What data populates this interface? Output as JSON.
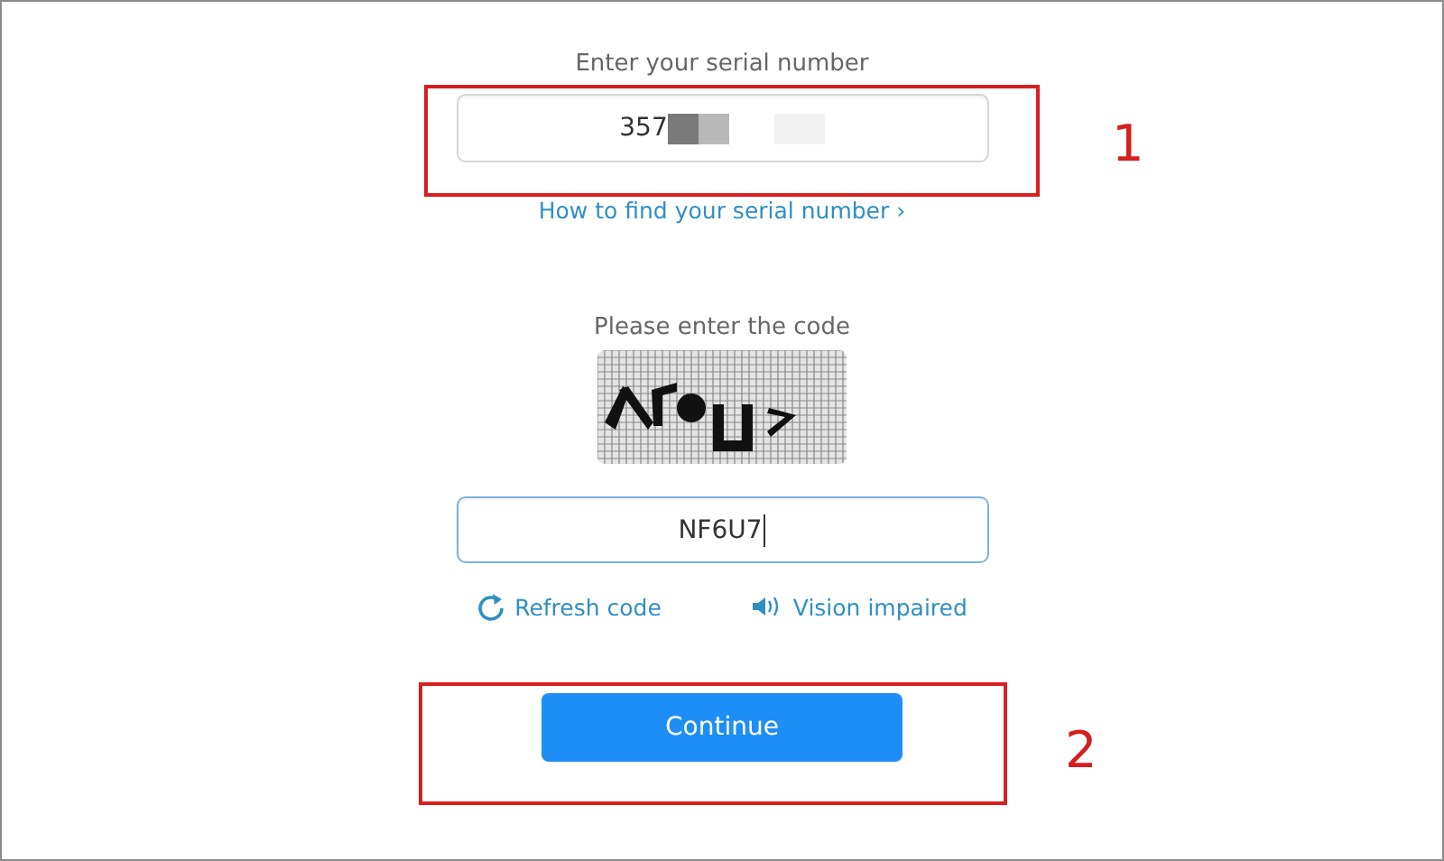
{
  "serial": {
    "label": "Enter your serial number",
    "value": "357",
    "redacted": true,
    "help_link": "How to find your serial number ›"
  },
  "captcha": {
    "label": "Please enter the code",
    "value": "NF6U7",
    "refresh": "Refresh code",
    "audio": "Vision impaired"
  },
  "continue_button": "Continue",
  "annotations": [
    {
      "number": "1"
    },
    {
      "number": "2"
    }
  ]
}
